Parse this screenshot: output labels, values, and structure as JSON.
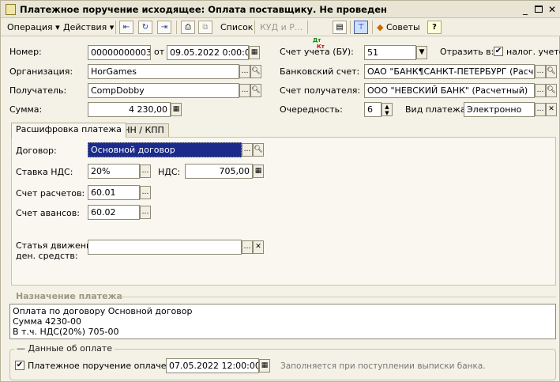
{
  "window": {
    "title": "Платежное поручение исходящее: Оплата поставщику. Не проведен"
  },
  "toolbar": {
    "operation": "Операция",
    "actions": "Действия",
    "list": "Список",
    "kud": "КУД и Р...",
    "dtkt_top": "Дт",
    "dtkt_bottom": "Кт",
    "advice": "Советы",
    "help": "?"
  },
  "header": {
    "number_label": "Номер:",
    "number_value": "00000000003",
    "from_label": "от",
    "date_value": "09.05.2022 0:00:00",
    "org_label": "Организация:",
    "org_value": "HorGames",
    "recipient_label": "Получатель:",
    "recipient_value": "CompDobby",
    "sum_label": "Сумма:",
    "sum_value": "4 230,00",
    "account_bu_label": "Счет учета (БУ):",
    "account_bu_value": "51",
    "reflect_label": "Отразить в:",
    "tax_label": "налог. учете",
    "tax_checked": true,
    "bank_account_label": "Банковский счет:",
    "bank_account_value": "ОАО \"БАНК¶САНКТ-ПЕТЕРБУРГ (Расчет",
    "recipient_account_label": "Счет получателя:",
    "recipient_account_value": "ООО \"НЕВСКИЙ БАНК\" (Расчетный)",
    "priority_label": "Очередность:",
    "priority_value": "6",
    "payment_type_label": "Вид платежа:",
    "payment_type_value": "Электронно"
  },
  "tabs": [
    {
      "label": "Расшифровка платежа",
      "active": true
    },
    {
      "label": "ИНН / КПП",
      "active": false
    }
  ],
  "details": {
    "contract_label": "Договор:",
    "contract_value": "Основной договор",
    "vat_rate_label": "Ставка НДС:",
    "vat_rate_value": "20%",
    "vat_label": "НДС:",
    "vat_value": "705,00",
    "settle_account_label": "Счет расчетов:",
    "settle_account_value": "60.01",
    "advance_account_label": "Счет авансов:",
    "advance_account_value": "60.02",
    "cashflow_label_1": "Статья движения",
    "cashflow_label_2": "ден. средств:",
    "cashflow_value": ""
  },
  "purpose": {
    "header": "Назначение платежа",
    "line1": "Оплата по договору Основной договор",
    "line2": "Сумма 4230-00",
    "line3": "В т.ч. НДС(20%) 705-00"
  },
  "payment": {
    "header": "Данные об оплате",
    "paid_label": "Платежное поручение оплачено:",
    "paid_checked": true,
    "paid_date": "07.05.2022 12:00:00",
    "hint": "Заполняется при поступлении выписки банка."
  },
  "colors": {
    "accent": "#1a2b8c",
    "frame": "#f4f1e6"
  }
}
